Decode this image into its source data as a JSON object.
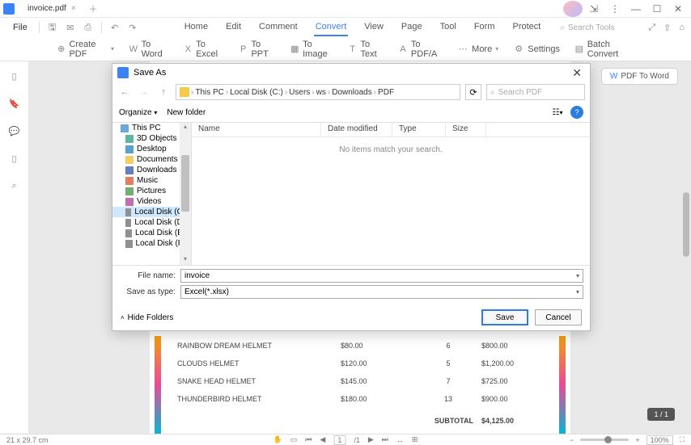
{
  "window": {
    "tab_title": "invoice.pdf",
    "file_menu": "File"
  },
  "main_tabs": {
    "home": "Home",
    "edit": "Edit",
    "comment": "Comment",
    "convert": "Convert",
    "view": "View",
    "page": "Page",
    "tool": "Tool",
    "form": "Form",
    "protect": "Protect"
  },
  "search_tools": "Search Tools",
  "toolbar": {
    "create_pdf": "Create PDF",
    "to_word": "To Word",
    "to_excel": "To Excel",
    "to_ppt": "To PPT",
    "to_image": "To Image",
    "to_text": "To Text",
    "to_pdfa": "To PDF/A",
    "more": "More",
    "settings": "Settings",
    "batch_convert": "Batch Convert"
  },
  "pdf_to_word_btn": "PDF To Word",
  "invoice_rows": [
    {
      "name": "RAINBOW DREAM HELMET",
      "price": "$80.00",
      "qty": "6",
      "total": "$800.00"
    },
    {
      "name": "CLOUDS HELMET",
      "price": "$120.00",
      "qty": "5",
      "total": "$1,200.00"
    },
    {
      "name": "SNAKE HEAD HELMET",
      "price": "$145.00",
      "qty": "7",
      "total": "$725.00"
    },
    {
      "name": "THUNDERBIRD HELMET",
      "price": "$180.00",
      "qty": "13",
      "total": "$900.00"
    }
  ],
  "subtotal_label": "SUBTOTAL",
  "subtotal_value": "$4,125.00",
  "page_indicator": "1 / 1",
  "status": {
    "dimensions": "21 x 29.7 cm",
    "page_current": "1",
    "page_total": "/1",
    "zoom": "100%"
  },
  "dialog": {
    "title": "Save As",
    "breadcrumb": [
      "This PC",
      "Local Disk (C:)",
      "Users",
      "ws",
      "Downloads",
      "PDF"
    ],
    "search_placeholder": "Search PDF",
    "organize": "Organize",
    "new_folder": "New folder",
    "tree": [
      {
        "label": "This PC",
        "icon": "pc",
        "level": 1
      },
      {
        "label": "3D Objects",
        "icon": "obj3d",
        "level": 2
      },
      {
        "label": "Desktop",
        "icon": "desk",
        "level": 2
      },
      {
        "label": "Documents",
        "icon": "docs",
        "level": 2
      },
      {
        "label": "Downloads",
        "icon": "down",
        "level": 2
      },
      {
        "label": "Music",
        "icon": "music",
        "level": 2
      },
      {
        "label": "Pictures",
        "icon": "pics",
        "level": 2
      },
      {
        "label": "Videos",
        "icon": "vids",
        "level": 2
      },
      {
        "label": "Local Disk (C:)",
        "icon": "drive",
        "level": 2,
        "selected": true
      },
      {
        "label": "Local Disk (D:)",
        "icon": "drive",
        "level": 2
      },
      {
        "label": "Local Disk (E:)",
        "icon": "drive",
        "level": 2
      },
      {
        "label": "Local Disk (F:)",
        "icon": "drive",
        "level": 2
      }
    ],
    "columns": {
      "name": "Name",
      "date": "Date modified",
      "type": "Type",
      "size": "Size"
    },
    "empty_message": "No items match your search.",
    "filename_label": "File name:",
    "filename_value": "invoice",
    "saveas_label": "Save as type:",
    "saveas_value": "Excel(*.xlsx)",
    "hide_folders": "Hide Folders",
    "save_btn": "Save",
    "cancel_btn": "Cancel"
  }
}
